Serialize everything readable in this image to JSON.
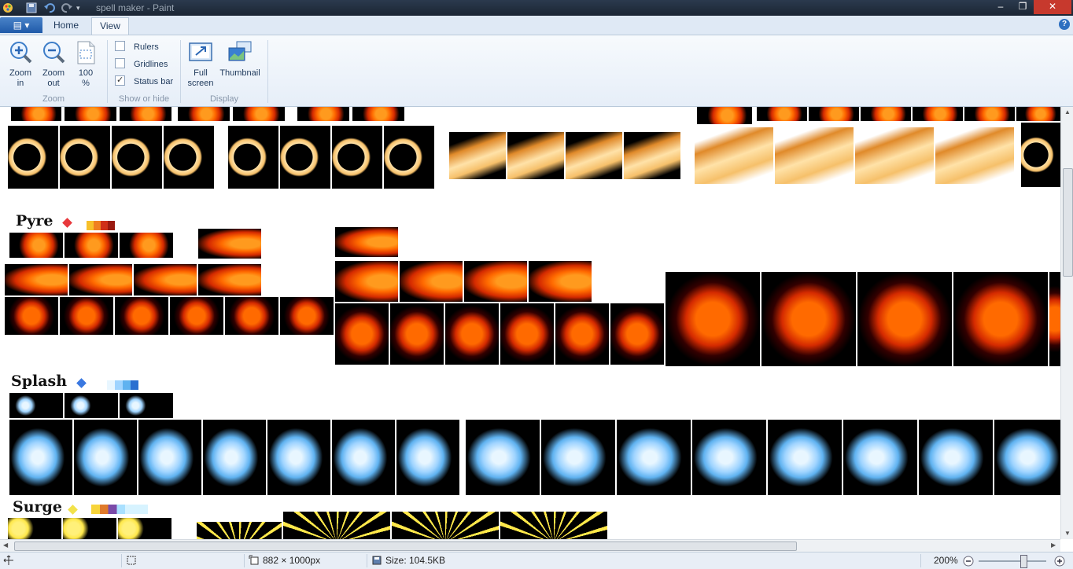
{
  "window": {
    "title": "spell maker - Paint",
    "minimize_glyph": "–",
    "maximize_glyph": "❐",
    "close_glyph": "✕"
  },
  "ribbon_tabs": {
    "file_glyph": "▤ ▾",
    "home": "Home",
    "view": "View",
    "help_glyph": "?"
  },
  "zoom_group": {
    "zoom_in": "Zoom in",
    "zoom_in_l1": "Zoom",
    "zoom_in_l2": "in",
    "zoom_out_l1": "Zoom",
    "zoom_out_l2": "out",
    "hundred_l1": "100",
    "hundred_l2": "%",
    "label": "Zoom"
  },
  "show_hide_group": {
    "rulers": {
      "label": "Rulers",
      "checked": false
    },
    "gridlines": {
      "label": "Gridlines",
      "checked": false
    },
    "status_bar": {
      "label": "Status bar",
      "checked": true
    },
    "label": "Show or hide"
  },
  "display_group": {
    "full_screen_l1": "Full",
    "full_screen_l2": "screen",
    "thumbnail": "Thumbnail",
    "label": "Display"
  },
  "canvas": {
    "sections": [
      {
        "name": "Pyre",
        "icon_color": "#e8383c"
      },
      {
        "name": "Splash",
        "icon_color": "#3a78e0"
      },
      {
        "name": "Surge",
        "icon_color": "#f2e24a"
      }
    ]
  },
  "status_bar": {
    "image_size": "882 × 1000px",
    "file_size": "Size: 104.5KB",
    "zoom": "200%",
    "zoom_level_fraction": 0.66
  },
  "colors": {
    "fire": [
      "#ff6a00",
      "#ff9a1e",
      "#d42a00"
    ],
    "water": [
      "#9fd4ff",
      "#5fb2f0",
      "#e8f6ff"
    ],
    "crescent": [
      "#f6c06a",
      "#ffe2a8",
      "#e08a2a"
    ],
    "surge": [
      "#fff07a",
      "#ffe84a"
    ]
  }
}
